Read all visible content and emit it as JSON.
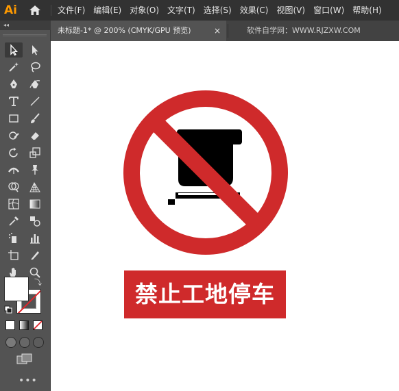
{
  "app": {
    "logo_text": "Ai"
  },
  "menu": [
    {
      "label": "文件(F)"
    },
    {
      "label": "编辑(E)"
    },
    {
      "label": "对象(O)"
    },
    {
      "label": "文字(T)"
    },
    {
      "label": "选择(S)"
    },
    {
      "label": "效果(C)"
    },
    {
      "label": "视图(V)"
    },
    {
      "label": "窗口(W)"
    },
    {
      "label": "帮助(H)"
    }
  ],
  "toolbar": {
    "collapse_glyph": "◂◂",
    "swap_glyph": "⤵",
    "more_glyph": "•••"
  },
  "tabs": {
    "active": {
      "title": "未标题-1* @ 200% (CMYK/GPU 预览)",
      "close_glyph": "×"
    },
    "inactive": {
      "title": "软件自学网：WWW.RJZXW.COM"
    }
  },
  "canvas": {
    "banner_text": "禁止工地停车",
    "colors": {
      "prohibition_red": "#cf2a2b",
      "symbol_black": "#000000",
      "background": "#ffffff"
    }
  },
  "tools": [
    "selection-tool",
    "direct-selection-tool",
    "magic-wand-tool",
    "lasso-tool",
    "pen-tool",
    "curvature-tool",
    "type-tool",
    "line-segment-tool",
    "rectangle-tool",
    "paintbrush-tool",
    "shaper-tool",
    "eraser-tool",
    "rotate-tool",
    "scale-tool",
    "width-tool",
    "puppet-warp-tool",
    "shape-builder-tool",
    "perspective-grid-tool",
    "mesh-tool",
    "gradient-tool",
    "eyedropper-tool",
    "blend-tool",
    "symbol-sprayer-tool",
    "column-graph-tool",
    "artboard-tool",
    "slice-tool",
    "hand-tool",
    "zoom-tool"
  ]
}
